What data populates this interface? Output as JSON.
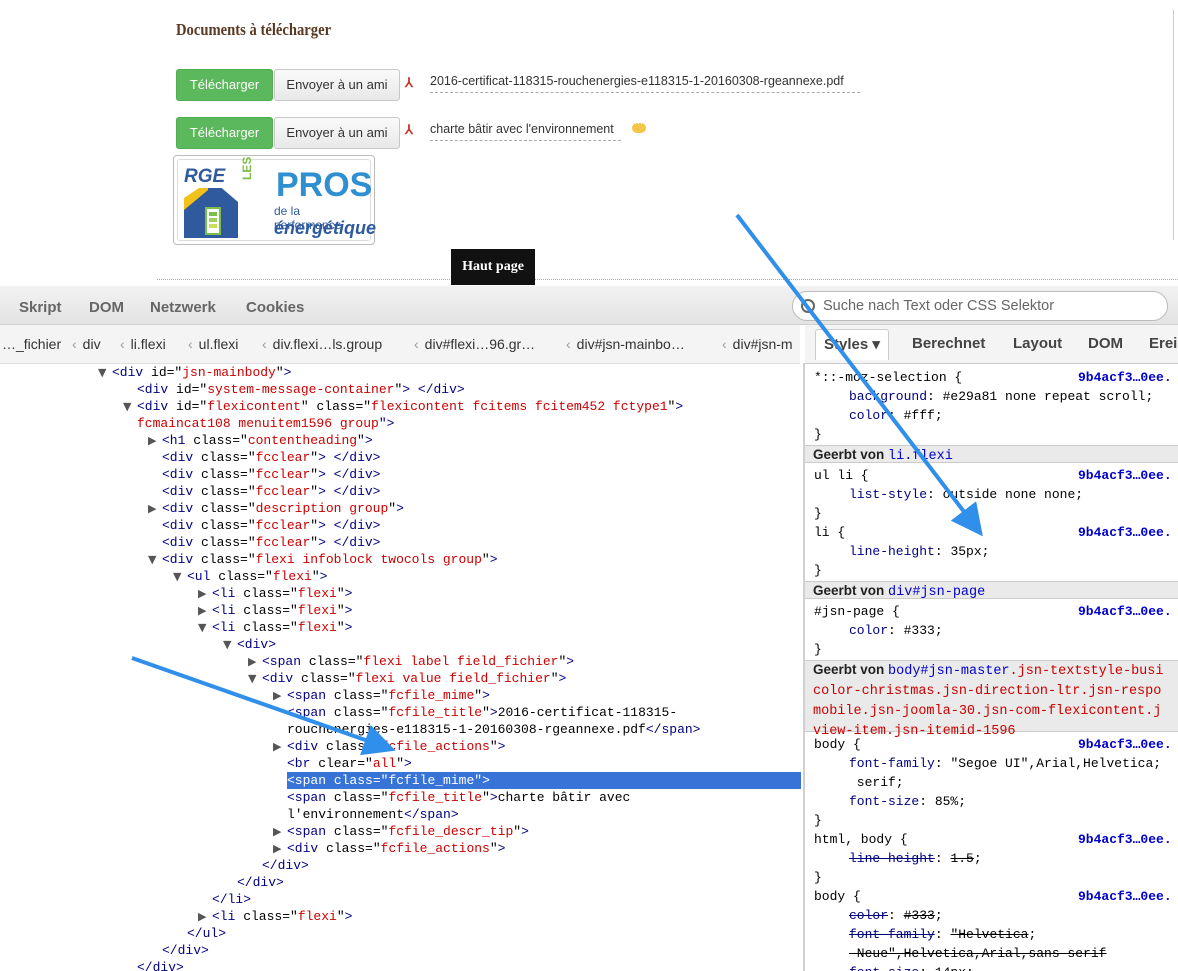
{
  "page": {
    "section_title": "Documents à télécharger",
    "download_label": "Télécharger",
    "send_label": "Envoyer à un ami",
    "files": [
      {
        "name": "2016-certificat-118315-rouchenergies-e118315-1-20160308-rgeannexe.pdf"
      },
      {
        "name": "charte bâtir avec l'environnement"
      }
    ],
    "logo": {
      "badge": "RGE",
      "les": "LES",
      "pros": "PROS",
      "line1": "de la performance",
      "line2": "énergétique"
    },
    "back_to_top": "Haut page"
  },
  "devtools": {
    "toolbar_tabs": [
      "Skript",
      "DOM",
      "Netzwerk",
      "Cookies"
    ],
    "search_placeholder": "Suche nach Text oder CSS Selektor",
    "breadcrumbs": [
      "…_fichier",
      "div",
      "li.flexi",
      "ul.flexi",
      "div.flexi…ls.group",
      "div#flexi…96.gr…",
      "div#jsn-mainbo…",
      "div#jsn-m"
    ],
    "side_tabs": [
      "Styles",
      "Berechnet",
      "Layout",
      "DOM",
      "Erei"
    ]
  },
  "html_tree": [
    {
      "d": 4,
      "tw": "▼",
      "tag": "div",
      "attrs": [
        [
          "id",
          "jsn-mainbody"
        ]
      ],
      "close": false
    },
    {
      "d": 5,
      "tw": "",
      "tag": "div",
      "attrs": [
        [
          "id",
          "system-message-container"
        ]
      ],
      "close": true
    },
    {
      "d": 5,
      "tw": "▼",
      "tag": "div",
      "attrs": [
        [
          "id",
          "flexicontent"
        ],
        [
          "class",
          "flexicontent fcitems fcitem452 fctype1"
        ]
      ],
      "close": false
    },
    {
      "d": 5,
      "tw": "",
      "raw": "fcmaincat108 menuitem1596 group\">",
      "cont": true
    },
    {
      "d": 6,
      "tw": "▶",
      "tag": "h1",
      "attrs": [
        [
          "class",
          "contentheading"
        ]
      ],
      "close": false
    },
    {
      "d": 6,
      "tw": "",
      "tag": "div",
      "attrs": [
        [
          "class",
          "fcclear"
        ]
      ],
      "close": true
    },
    {
      "d": 6,
      "tw": "",
      "tag": "div",
      "attrs": [
        [
          "class",
          "fcclear"
        ]
      ],
      "close": true
    },
    {
      "d": 6,
      "tw": "",
      "tag": "div",
      "attrs": [
        [
          "class",
          "fcclear"
        ]
      ],
      "close": true
    },
    {
      "d": 6,
      "tw": "▶",
      "tag": "div",
      "attrs": [
        [
          "class",
          "description group"
        ]
      ],
      "close": false
    },
    {
      "d": 6,
      "tw": "",
      "tag": "div",
      "attrs": [
        [
          "class",
          "fcclear"
        ]
      ],
      "close": true
    },
    {
      "d": 6,
      "tw": "",
      "tag": "div",
      "attrs": [
        [
          "class",
          "fcclear"
        ]
      ],
      "close": true
    },
    {
      "d": 6,
      "tw": "▼",
      "tag": "div",
      "attrs": [
        [
          "class",
          "flexi infoblock twocols group"
        ]
      ],
      "close": false
    },
    {
      "d": 7,
      "tw": "▼",
      "tag": "ul",
      "attrs": [
        [
          "class",
          "flexi"
        ]
      ],
      "close": false
    },
    {
      "d": 8,
      "tw": "▶",
      "tag": "li",
      "attrs": [
        [
          "class",
          "flexi"
        ]
      ],
      "close": false
    },
    {
      "d": 8,
      "tw": "▶",
      "tag": "li",
      "attrs": [
        [
          "class",
          "flexi"
        ]
      ],
      "close": false
    },
    {
      "d": 8,
      "tw": "▼",
      "tag": "li",
      "attrs": [
        [
          "class",
          "flexi"
        ]
      ],
      "close": false
    },
    {
      "d": 9,
      "tw": "▼",
      "tag": "div",
      "attrs": [],
      "close": false
    },
    {
      "d": 10,
      "tw": "▶",
      "tag": "span",
      "attrs": [
        [
          "class",
          "flexi label field_fichier"
        ]
      ],
      "close": false
    },
    {
      "d": 10,
      "tw": "▼",
      "tag": "div",
      "attrs": [
        [
          "class",
          "flexi value field_fichier"
        ]
      ],
      "close": false
    },
    {
      "d": 11,
      "tw": "▶",
      "tag": "span",
      "attrs": [
        [
          "class",
          "fcfile_mime"
        ]
      ],
      "close": false
    },
    {
      "d": 11,
      "tw": "",
      "tag": "span",
      "attrs": [
        [
          "class",
          "fcfile_title"
        ]
      ],
      "text": "2016-certificat-118315-",
      "close": false
    },
    {
      "d": 11,
      "tw": "",
      "raw": "rouchenergies-e118315-1-20160308-rgeannexe.pdf",
      "endtag": "span",
      "cont": true
    },
    {
      "d": 11,
      "tw": "▶",
      "tag": "div",
      "attrs": [
        [
          "class",
          "fcfile_actions"
        ]
      ],
      "close": false
    },
    {
      "d": 11,
      "tw": "",
      "tag": "br",
      "attrs": [
        [
          "clear",
          "all"
        ]
      ],
      "close": false
    },
    {
      "d": 11,
      "tw": "▶",
      "tag": "span",
      "attrs": [
        [
          "class",
          "fcfile_mime"
        ]
      ],
      "close": false,
      "selected": true
    },
    {
      "d": 11,
      "tw": "",
      "tag": "span",
      "attrs": [
        [
          "class",
          "fcfile_title"
        ]
      ],
      "text": "charte bâtir avec",
      "close": false
    },
    {
      "d": 11,
      "tw": "",
      "raw": "l'environnement",
      "endtag": "span",
      "cont": true
    },
    {
      "d": 11,
      "tw": "▶",
      "tag": "span",
      "attrs": [
        [
          "class",
          "fcfile_descr_tip"
        ]
      ],
      "close": false
    },
    {
      "d": 11,
      "tw": "▶",
      "tag": "div",
      "attrs": [
        [
          "class",
          "fcfile_actions"
        ]
      ],
      "close": false
    },
    {
      "d": 10,
      "tw": "",
      "end": "div"
    },
    {
      "d": 9,
      "tw": "",
      "end": "div"
    },
    {
      "d": 8,
      "tw": "",
      "end": "li"
    },
    {
      "d": 8,
      "tw": "▶",
      "tag": "li",
      "attrs": [
        [
          "class",
          "flexi"
        ]
      ],
      "close": false
    },
    {
      "d": 7,
      "tw": "",
      "end": "ul"
    },
    {
      "d": 6,
      "tw": "",
      "end": "div"
    },
    {
      "d": 5,
      "tw": "",
      "end": "div"
    }
  ],
  "style_rules": {
    "rule1": {
      "selector": "*::-moz-selection {",
      "src": "9b4acf3…0ee.",
      "decls": [
        [
          "background",
          "#e29a81 none repeat scroll"
        ],
        [
          "color",
          "#fff"
        ]
      ]
    },
    "inh1": {
      "label": "Geerbt von",
      "sel": "li.flexi"
    },
    "rule2": {
      "selector": "ul li {",
      "src": "9b4acf3…0ee.",
      "decls": [
        [
          "list-style",
          "outside none none"
        ]
      ]
    },
    "rule3": {
      "selector": "li {",
      "src": "9b4acf3…0ee.",
      "decls": [
        [
          "line-height",
          "35px"
        ]
      ]
    },
    "inh2": {
      "label": "Geerbt von",
      "sel": "div#jsn-page"
    },
    "rule4": {
      "selector": "#jsn-page {",
      "src": "9b4acf3…0ee.",
      "decls": [
        [
          "color",
          "#333"
        ]
      ]
    },
    "inh3": {
      "label": "Geerbt von",
      "sel": "body#jsn-master",
      "lines": [
        ".jsn-textstyle-busi",
        "color-christmas.jsn-direction-ltr.jsn-respo",
        "mobile.jsn-joomla-30.jsn-com-flexicontent.j",
        "view-item.jsn-itemid-1596"
      ]
    },
    "rule5": {
      "selector": "body {",
      "src": "9b4acf3…0ee.",
      "decls": [
        [
          "font-family",
          "\"Segoe UI\",Arial,Helvetica"
        ],
        [
          "",
          "serif;"
        ],
        [
          "font-size",
          "85%"
        ]
      ]
    },
    "rule6": {
      "selector": "html, body {",
      "src": "9b4acf3…0ee.",
      "decls": [
        [
          "line-height",
          "1.5"
        ]
      ]
    },
    "rule7": {
      "selector": "body {",
      "src": "9b4acf3…0ee.",
      "decls": [
        [
          "color",
          "#333"
        ],
        [
          "font-family",
          "\"Helvetica"
        ],
        [
          "",
          "Neue\",Helvetica,Arial,sans-serif"
        ],
        [
          "font-size",
          "14px"
        ]
      ]
    }
  }
}
